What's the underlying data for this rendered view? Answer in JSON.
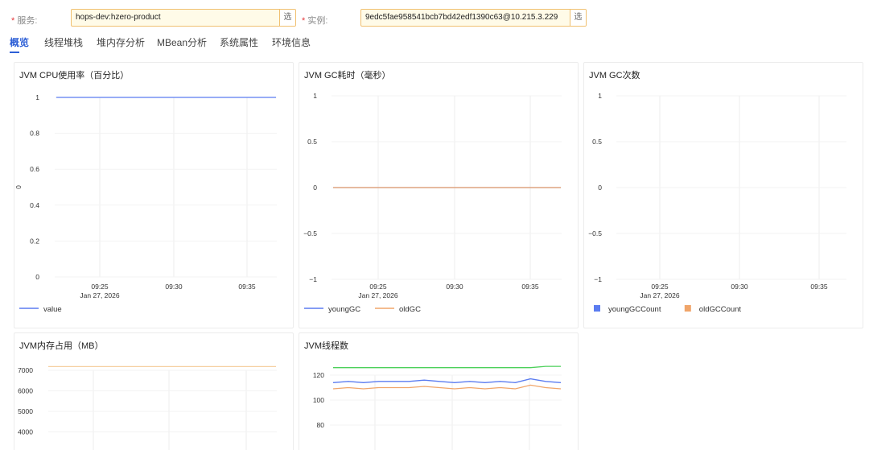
{
  "filters": {
    "service_label": "服务:",
    "service_value": "hops-dev:hzero-product",
    "instance_label": "实例:",
    "instance_value": "9edc5fae958541bcb7bd42edf1390c63@10.215.3.229",
    "select_btn": "选",
    "required_mark": "*"
  },
  "tabs": [
    {
      "label": "概览",
      "active": true
    },
    {
      "label": "线程堆栈",
      "active": false
    },
    {
      "label": "堆内存分析",
      "active": false
    },
    {
      "label": "MBean分析",
      "active": false
    },
    {
      "label": "系统属性",
      "active": false
    },
    {
      "label": "环境信息",
      "active": false
    }
  ],
  "colors": {
    "blue": "#5b7cf0",
    "orange": "#f0a56a",
    "green": "#4cd05a",
    "tan": "#f5cfa0"
  },
  "chart_data": [
    {
      "id": "cpu",
      "type": "line",
      "title": "JVM CPU使用率（百分比）",
      "ylabel": "0",
      "y_ticks": [
        "1",
        "0.8",
        "0.6",
        "0.4",
        "0.2",
        "0"
      ],
      "ylim": [
        0,
        1
      ],
      "x_ticks": [
        "09:25",
        "09:30",
        "09:35"
      ],
      "date_label": "Jan 27, 2026",
      "series": [
        {
          "name": "value",
          "values": [
            1,
            1,
            1,
            1,
            1,
            1,
            1,
            1,
            1,
            1,
            1,
            1,
            1,
            1,
            1,
            1
          ],
          "color": "#5b7cf0"
        }
      ]
    },
    {
      "id": "gc_time",
      "type": "line",
      "title": "JVM GC耗时（毫秒）",
      "y_ticks": [
        "1",
        "0.5",
        "0",
        "−0.5",
        "−1"
      ],
      "ylim": [
        -1,
        1
      ],
      "x_ticks": [
        "09:25",
        "09:30",
        "09:35"
      ],
      "date_label": "Jan 27, 2026",
      "series": [
        {
          "name": "youngGC",
          "values": [
            0,
            0,
            0,
            0,
            0,
            0,
            0,
            0,
            0,
            0,
            0,
            0,
            0,
            0,
            0,
            0
          ],
          "color": "#5b7cf0"
        },
        {
          "name": "oldGC",
          "values": [
            0,
            0,
            0,
            0,
            0,
            0,
            0,
            0,
            0,
            0,
            0,
            0,
            0,
            0,
            0,
            0
          ],
          "color": "#f0a56a"
        }
      ]
    },
    {
      "id": "gc_count",
      "type": "bar",
      "title": "JVM GC次数",
      "y_ticks": [
        "1",
        "0.5",
        "0",
        "−0.5",
        "−1"
      ],
      "ylim": [
        -1,
        1
      ],
      "x_ticks": [
        "09:25",
        "09:30",
        "09:35"
      ],
      "date_label": "Jan 27, 2026",
      "series": [
        {
          "name": "youngGCCount",
          "values": [],
          "color": "#5b7cf0"
        },
        {
          "name": "oldGCCount",
          "values": [],
          "color": "#f0a56a"
        }
      ]
    },
    {
      "id": "memory",
      "type": "line",
      "title": "JVM内存占用（MB）",
      "y_ticks": [
        "7000",
        "6000",
        "5000",
        "4000"
      ],
      "series": [
        {
          "name": "",
          "values": [
            7180,
            7180,
            7180,
            7180,
            7180,
            7180,
            7180,
            7180,
            7180,
            7180,
            7180,
            7180,
            7180,
            7180,
            7180,
            7180
          ],
          "color": "#f5cfa0"
        }
      ]
    },
    {
      "id": "threads",
      "type": "line",
      "title": "JVM线程数",
      "y_ticks": [
        "120",
        "100",
        "80"
      ],
      "series": [
        {
          "name": "",
          "values": [
            126,
            126,
            126,
            126,
            126,
            126,
            126,
            126,
            126,
            126,
            126,
            126,
            126,
            126,
            127,
            127
          ],
          "color": "#4cd05a"
        },
        {
          "name": "",
          "values": [
            114,
            115,
            114,
            115,
            115,
            115,
            116,
            115,
            114,
            115,
            114,
            115,
            114,
            117,
            115,
            114
          ],
          "color": "#5b7cf0"
        },
        {
          "name": "",
          "values": [
            109,
            110,
            109,
            110,
            110,
            110,
            111,
            110,
            109,
            110,
            109,
            110,
            109,
            112,
            110,
            109
          ],
          "color": "#f0a56a"
        }
      ]
    }
  ]
}
